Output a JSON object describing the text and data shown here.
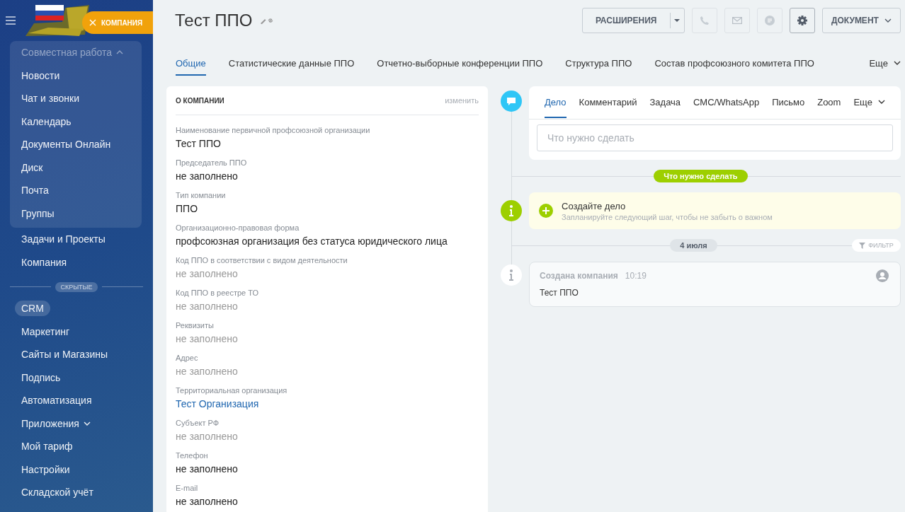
{
  "sidebar": {
    "badge": "КОМПАНИЯ",
    "group": {
      "label": "Совместная работа",
      "expanded": true,
      "items": [
        {
          "label": "Новости"
        },
        {
          "label": "Чат и звонки"
        },
        {
          "label": "Календарь"
        },
        {
          "label": "Документы Онлайн"
        },
        {
          "label": "Диск"
        },
        {
          "label": "Почта"
        },
        {
          "label": "Группы"
        }
      ]
    },
    "items": [
      {
        "label": "Задачи и Проекты",
        "selected": false,
        "expandable": false
      },
      {
        "label": "Компания",
        "selected": false,
        "expandable": false
      }
    ],
    "hidden_label": "СКРЫТЫЕ",
    "hidden_items": [
      {
        "label": "CRM",
        "selected": true,
        "expandable": false
      },
      {
        "label": "Маркетинг",
        "selected": false,
        "expandable": false
      },
      {
        "label": "Сайты и Магазины",
        "selected": false,
        "expandable": false
      },
      {
        "label": "Подпись",
        "selected": false,
        "expandable": false
      },
      {
        "label": "Автоматизация",
        "selected": false,
        "expandable": false
      },
      {
        "label": "Приложения",
        "selected": false,
        "expandable": true
      },
      {
        "label": "Мой тариф",
        "selected": false,
        "expandable": false
      },
      {
        "label": "Настройки",
        "selected": false,
        "expandable": false
      },
      {
        "label": "Складской учёт",
        "selected": false,
        "expandable": false
      }
    ]
  },
  "header": {
    "title": "Тест ППО",
    "extensions": "РАСШИРЕНИЯ",
    "document": "ДОКУМЕНТ"
  },
  "tabs": [
    {
      "label": "Общие",
      "selected": true
    },
    {
      "label": "Статистические данные ППО",
      "selected": false
    },
    {
      "label": "Отчетно-выборные конференции ППО",
      "selected": false
    },
    {
      "label": "Структура ППО",
      "selected": false
    },
    {
      "label": "Состав профсоюзного комитета ППО",
      "selected": false
    }
  ],
  "tabs_more": "Еще",
  "company": {
    "title": "О КОМПАНИИ",
    "edit": "изменить",
    "fields": [
      {
        "label": "Наименование первичной профсоюзной организации",
        "value": "Тест ППО",
        "kind": "text",
        "empty": false
      },
      {
        "label": "Председатель ППО",
        "value": "не заполнено",
        "kind": "text",
        "empty": false
      },
      {
        "label": "Тип компании",
        "value": "ППО",
        "kind": "text",
        "empty": false
      },
      {
        "label": "Организационно-правовая форма",
        "value": "профсоюзная организация без статуса юридического лица",
        "kind": "text",
        "empty": false
      },
      {
        "label": "Код ППО в соответствии с видом деятельности",
        "value": "не заполнено",
        "kind": "text",
        "empty": true
      },
      {
        "label": "Код ППО в реестре ТО",
        "value": "не заполнено",
        "kind": "text",
        "empty": true
      },
      {
        "label": "Реквизиты",
        "value": "не заполнено",
        "kind": "text",
        "empty": true
      },
      {
        "label": "Адрес",
        "value": "не заполнено",
        "kind": "text",
        "empty": true
      },
      {
        "label": "Территориальная организация",
        "value": "Тест Организация",
        "kind": "link",
        "empty": false
      },
      {
        "label": "Субъект РФ",
        "value": "не заполнено",
        "kind": "text",
        "empty": true
      },
      {
        "label": "Телефон",
        "value": "не заполнено",
        "kind": "text",
        "empty": false
      },
      {
        "label": "E-mail",
        "value": "не заполнено",
        "kind": "text",
        "empty": false
      }
    ]
  },
  "timeline": {
    "editor_tabs": [
      {
        "label": "Дело",
        "selected": true
      },
      {
        "label": "Комментарий",
        "selected": false
      },
      {
        "label": "Задача",
        "selected": false
      },
      {
        "label": "СМС/WhatsApp",
        "selected": false
      },
      {
        "label": "Письмо",
        "selected": false
      },
      {
        "label": "Zoom",
        "selected": false
      }
    ],
    "editor_more": "Еще",
    "placeholder": "Что нужно сделать",
    "planned_label": "Что нужно сделать",
    "create": {
      "title": "Создайте дело",
      "subtitle": "Запланируйте следующий шаг, чтобы не забыть о важном"
    },
    "date": "4 июля",
    "filter": "ФИЛЬТР",
    "event": {
      "title": "Создана компания",
      "time": "10:19",
      "text": "Тест ППО"
    }
  }
}
